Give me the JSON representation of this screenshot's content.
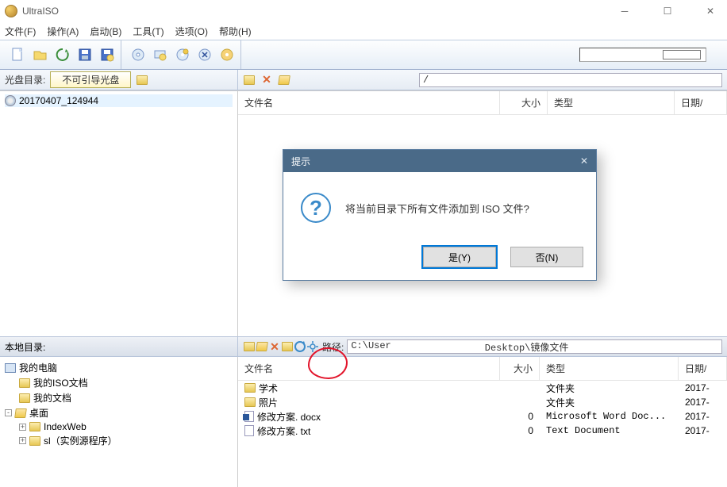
{
  "app": {
    "title": "UltraISO"
  },
  "menu": {
    "file": "文件(F)",
    "operate": "操作(A)",
    "start": "启动(B)",
    "tools": "工具(T)",
    "options": "选项(O)",
    "help": "帮助(H)"
  },
  "toolbar": {
    "icons": [
      "new",
      "open",
      "save",
      "saveas",
      "burn",
      "mount",
      "convert",
      "compress",
      "verify"
    ]
  },
  "disc": {
    "label": "光盘目录:",
    "select_value": "不可引导光盘"
  },
  "upper_right": {
    "path": "/",
    "cols": {
      "name": "文件名",
      "size": "大小",
      "type": "类型",
      "date": "日期/"
    }
  },
  "tree_top": {
    "item": "20170407_124944"
  },
  "dialog": {
    "title": "提示",
    "message": "将当前目录下所有文件添加到 ISO 文件?",
    "yes": "是(Y)",
    "no": "否(N)"
  },
  "local": {
    "label": "本地目录:",
    "path_label": "路径:",
    "path_before": "C:\\User",
    "path_after": "Desktop\\镜像文件"
  },
  "tree_bottom": {
    "computer": "我的电脑",
    "iso_docs": "我的ISO文档",
    "my_docs": "我的文档",
    "desktop": "桌面",
    "indexweb": "IndexWeb",
    "sl": "sl（实例源程序）"
  },
  "files": {
    "cols": {
      "name": "文件名",
      "size": "大小",
      "type": "类型",
      "date": "日期/"
    },
    "rows": [
      {
        "icon": "folder",
        "name": "学术",
        "size": "",
        "type": "文件夹",
        "date": "2017-"
      },
      {
        "icon": "folder",
        "name": "照片",
        "size": "",
        "type": "文件夹",
        "date": "2017-"
      },
      {
        "icon": "word",
        "name": "修改方案. docx",
        "size": "0",
        "type": "Microsoft Word Doc...",
        "date": "2017-"
      },
      {
        "icon": "doc",
        "name": "修改方案. txt",
        "size": "0",
        "type": "Text Document",
        "date": "2017-"
      }
    ]
  }
}
